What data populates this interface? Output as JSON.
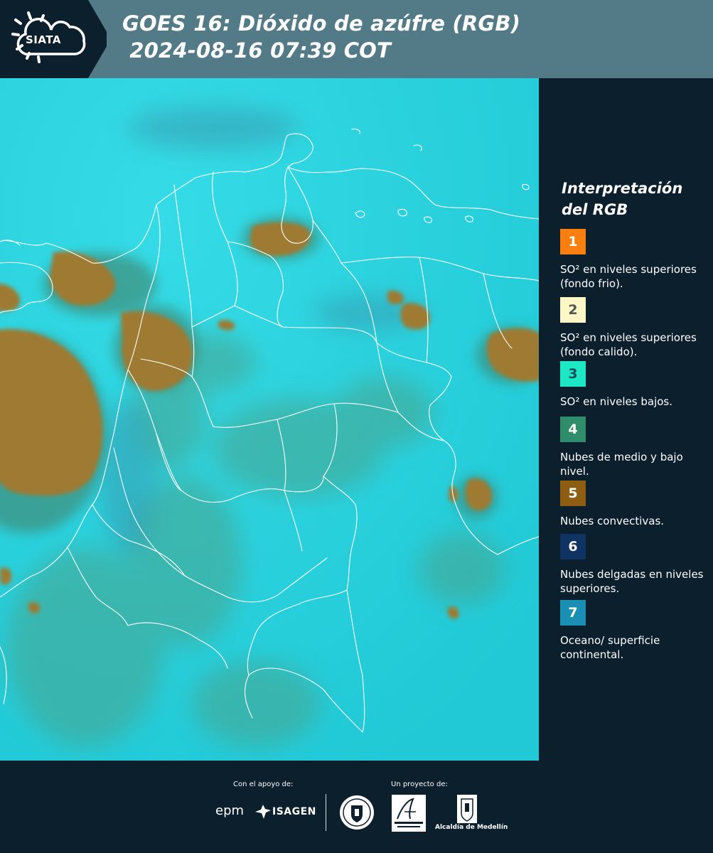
{
  "header": {
    "brand": "SIATA",
    "title_line1": "GOES 16: Dióxido de azúfre (RGB)",
    "title_line2": " 2024-08-16 07:39 COT"
  },
  "legend": {
    "heading": "Interpretación del RGB",
    "items": [
      {
        "num": "1",
        "label": "SO² en niveles superiores (fondo frio).",
        "color": "#fb7f0f",
        "text_color": "#ffffff"
      },
      {
        "num": "2",
        "label": "SO² en niveles superiores (fondo calido).",
        "color": "#fff8c6",
        "text_color": "#555555"
      },
      {
        "num": "3",
        "label": "SO² en niveles bajos.",
        "color": "#1ce8c6",
        "text_color": "#1d4d56"
      },
      {
        "num": "4",
        "label": "Nubes de medio y bajo nivel.",
        "color": "#2f8e69",
        "text_color": "#ffffff"
      },
      {
        "num": "5",
        "label": "Nubes convectivas.",
        "color": "#8d5e12",
        "text_color": "#ffffff"
      },
      {
        "num": "6",
        "label": "Nubes delgadas en niveles superiores.",
        "color": "#0f3363",
        "text_color": "#ffffff"
      },
      {
        "num": "7",
        "label": "Oceano/ superficie continental.",
        "color": "#1b8fb3",
        "text_color": "#ffffff"
      }
    ]
  },
  "footer": {
    "support_label": "Con el apoyo de:",
    "project_label": "Un proyecto de:",
    "sponsor_epm": "epm",
    "sponsor_isagen": "ISAGEN",
    "medellin_label": "Alcaldía de Medellín"
  },
  "colors": {
    "panel_bg": "#0c1f2c",
    "header_bar": "#527a87",
    "map_background": "#28d4df",
    "convective_cloud": "#9e7a32",
    "low_cloud": "#4aa38c",
    "borders": "#ffffff"
  },
  "icons": [
    "sun-cloud-logo-icon",
    "isagen-logo-icon",
    "medellin-seal-icon",
    "area-metropolitana-logo-icon",
    "alcaldia-medellin-logo-icon"
  ]
}
